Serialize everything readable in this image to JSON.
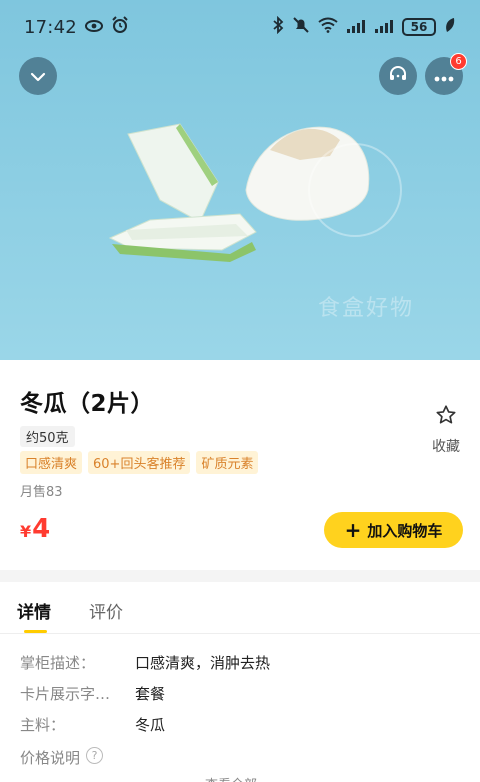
{
  "status": {
    "time": "17:42",
    "battery": "56"
  },
  "hero": {
    "watermark": "食盒好物"
  },
  "header": {
    "more_badge": "6"
  },
  "product": {
    "title": "冬瓜（2片）",
    "weight": "约50克",
    "tags": [
      "口感清爽",
      "60+回头客推荐",
      "矿质元素"
    ],
    "sales": "月售83",
    "price_symbol": "¥",
    "price": "4",
    "favorite_label": "收藏",
    "add_to_cart": "加入购物车"
  },
  "details": {
    "tabs": [
      "详情",
      "评价"
    ],
    "rows": [
      {
        "label": "掌柜描述：",
        "value": "口感清爽，消肿去热"
      },
      {
        "label": "卡片展示字…",
        "value": "套餐"
      },
      {
        "label": "主料：",
        "value": "冬瓜"
      },
      {
        "label": "价格说明",
        "value": ""
      }
    ],
    "expand": "查看全部"
  },
  "colors": {
    "hero_bg": "#8ecfe3",
    "accent_yellow": "#ffd21e",
    "price_red": "#ff3b30",
    "tag_bg": "#fff3d6",
    "tag_text": "#d9822b"
  }
}
